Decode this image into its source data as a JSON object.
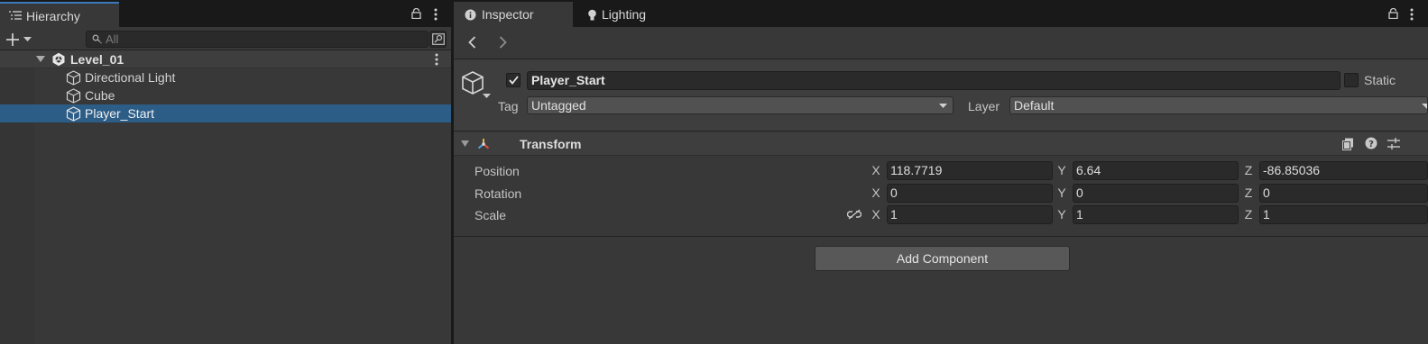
{
  "hierarchy": {
    "tab_label": "Hierarchy",
    "search_placeholder": "All",
    "scene_name": "Level_01",
    "items": [
      {
        "label": "Directional Light",
        "selected": false
      },
      {
        "label": "Cube",
        "selected": false
      },
      {
        "label": "Player_Start",
        "selected": true
      }
    ],
    "icons": [
      "list-icon",
      "lock-icon",
      "kebab-menu-icon",
      "plus-icon",
      "chevron-down-icon",
      "search-icon",
      "scene-search-icon",
      "unity-scene-icon",
      "gameobject-cube-icon"
    ]
  },
  "inspector": {
    "tabs": [
      {
        "label": "Inspector",
        "icon": "info-icon",
        "active": true
      },
      {
        "label": "Lighting",
        "icon": "bulb-icon",
        "active": false
      }
    ],
    "object": {
      "active": true,
      "name": "Player_Start",
      "static_label": "Static",
      "static": false,
      "tag_label": "Tag",
      "tag_value": "Untagged",
      "layer_label": "Layer",
      "layer_value": "Default"
    },
    "transform": {
      "title": "Transform",
      "rows": [
        {
          "label": "Position",
          "x": "118.7719",
          "y": "6.64",
          "z": "-86.85036"
        },
        {
          "label": "Rotation",
          "x": "0",
          "y": "0",
          "z": "0"
        },
        {
          "label": "Scale",
          "x": "1",
          "y": "1",
          "z": "1"
        }
      ],
      "axis_labels": {
        "x": "X",
        "y": "Y",
        "z": "Z"
      }
    },
    "add_component_label": "Add Component"
  },
  "colors": {
    "selection": "#2c5d87",
    "tab_accent": "#3a79bb",
    "panel_bg": "#383838",
    "field_bg": "#2a2a2a"
  }
}
